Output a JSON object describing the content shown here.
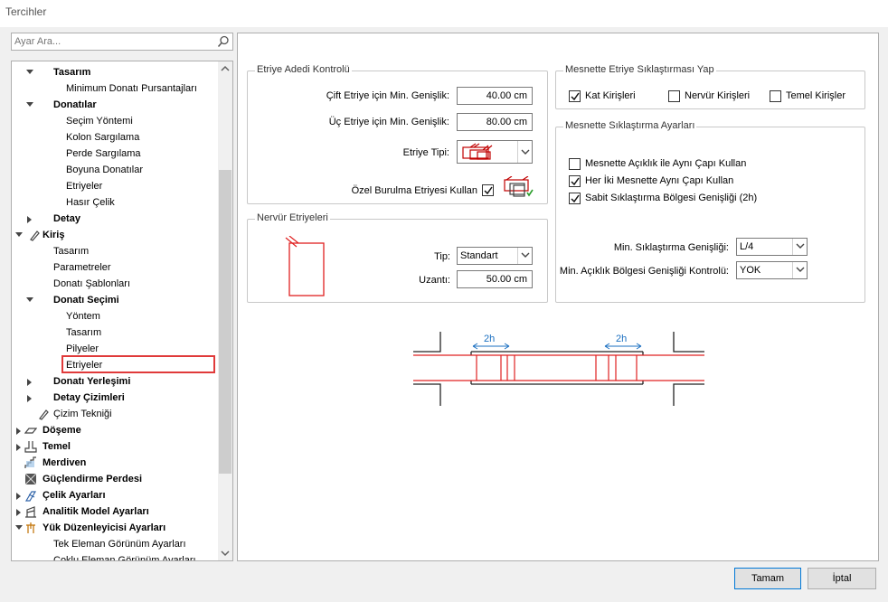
{
  "window": {
    "title": "Tercihler"
  },
  "search": {
    "placeholder": "Ayar Ara..."
  },
  "tree": [
    {
      "label": "Tasarım",
      "bold": true,
      "expanded": true
    },
    {
      "label": "Minimum Donatı Pursantajları",
      "bold": false
    },
    {
      "label": "Donatılar",
      "bold": true,
      "expanded": true
    },
    {
      "label": "Seçim Yöntemi",
      "bold": false
    },
    {
      "label": "Kolon Sargılama",
      "bold": false
    },
    {
      "label": "Perde Sargılama",
      "bold": false
    },
    {
      "label": "Boyuna Donatılar",
      "bold": false
    },
    {
      "label": "Etriyeler",
      "bold": false
    },
    {
      "label": "Hasır Çelik",
      "bold": false
    },
    {
      "label": "Detay",
      "bold": true,
      "expanded": false
    },
    {
      "label": "Kiriş",
      "bold": true,
      "expanded": true,
      "icon": "beam-icon"
    },
    {
      "label": "Tasarım",
      "bold": false
    },
    {
      "label": "Parametreler",
      "bold": false
    },
    {
      "label": "Donatı Şablonları",
      "bold": false
    },
    {
      "label": "Donatı Seçimi",
      "bold": true,
      "expanded": true
    },
    {
      "label": "Yöntem",
      "bold": false
    },
    {
      "label": "Tasarım",
      "bold": false
    },
    {
      "label": "Pilyeler",
      "bold": false
    },
    {
      "label": "Etriyeler",
      "bold": false,
      "selected": true
    },
    {
      "label": "Donatı Yerleşimi",
      "bold": true,
      "expanded": false
    },
    {
      "label": "Detay Çizimleri",
      "bold": true,
      "expanded": false
    },
    {
      "label": "Çizim Tekniği",
      "bold": false,
      "icon": "pencil-icon"
    },
    {
      "label": "Döşeme",
      "bold": true,
      "expanded": false,
      "icon": "slab-icon"
    },
    {
      "label": "Temel",
      "bold": true,
      "expanded": false,
      "icon": "foundation-icon"
    },
    {
      "label": "Merdiven",
      "bold": true,
      "icon": "stair-icon"
    },
    {
      "label": "Güçlendirme Perdesi",
      "bold": true,
      "icon": "shear-wall-icon"
    },
    {
      "label": "Çelik Ayarları",
      "bold": true,
      "expanded": false,
      "icon": "steel-icon"
    },
    {
      "label": "Analitik Model Ayarları",
      "bold": true,
      "expanded": false,
      "icon": "analytic-icon"
    },
    {
      "label": "Yük Düzenleyicisi Ayarları",
      "bold": true,
      "expanded": true,
      "icon": "load-icon"
    },
    {
      "label": "Tek Eleman Görünüm Ayarları",
      "bold": false
    },
    {
      "label": "Çoklu Eleman Görünüm Ayarları",
      "bold": false
    }
  ],
  "etriye_adedi": {
    "title": "Etriye Adedi Kontrolü",
    "cift_label": "Çift Etriye için Min. Genişlik:",
    "cift_value": "40.00 cm",
    "uc_label": "Üç Etriye için Min. Genişlik:",
    "uc_value": "80.00 cm",
    "tip_label": "Etriye Tipi:",
    "ozel_label": "Özel Burulma Etriyesi Kullan",
    "ozel_checked": true
  },
  "nervur": {
    "title": "Nervür Etriyeleri",
    "tip_label": "Tip:",
    "tip_value": "Standart",
    "uzanti_label": "Uzantı:",
    "uzanti_value": "50.00 cm"
  },
  "mesnette_etriye": {
    "title": "Mesnette Etriye Sıklaştırması Yap",
    "kat": {
      "label": "Kat Kirişleri",
      "checked": true
    },
    "nervur": {
      "label": "Nervür Kirişleri",
      "checked": false
    },
    "temel": {
      "label": "Temel Kirişler",
      "checked": false
    }
  },
  "siklastirma": {
    "title": "Mesnette Sıklaştırma Ayarları",
    "opt1": {
      "label": "Mesnette Açıklık ile Aynı Çapı Kullan",
      "checked": false
    },
    "opt2": {
      "label": "Her İki Mesnette Aynı Çapı Kullan",
      "checked": true
    },
    "opt3": {
      "label": "Sabit Sıklaştırma Bölgesi Genişliği (2h)",
      "checked": true
    },
    "min_label": "Min. Sıklaştırma Genişliği:",
    "min_value": "L/4",
    "acik_label": "Min. Açıklık Bölgesi Genişliği Kontrolü:",
    "acik_value": "YOK"
  },
  "diagram": {
    "left_label": "2h",
    "right_label": "2h"
  },
  "buttons": {
    "ok": "Tamam",
    "cancel": "İptal"
  },
  "colors": {
    "accent": "#0078d7",
    "highlight": "#e03a3a",
    "drawing": "#e02020",
    "dim": "#1a6fc0"
  }
}
